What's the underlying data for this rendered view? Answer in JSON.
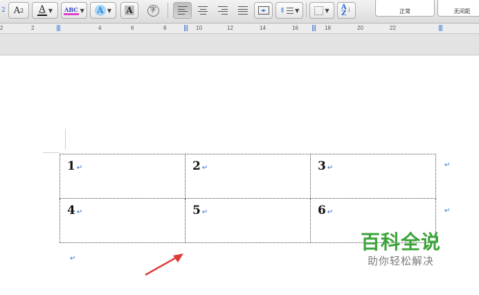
{
  "toolbar": {
    "subscript_glyph": "A",
    "subscript_sub": "2",
    "font_color_glyph": "A",
    "highlight_label": "ABC",
    "text_effects_glyph": "A",
    "char_shading_glyph": "A",
    "enclose_glyph": "字",
    "font_color_bar": "#111111",
    "highlight_color": "#e040c8",
    "text_effects_color": "#2d8bd6"
  },
  "styles": {
    "normal_label": "正常",
    "no_spacing_label": "无间距"
  },
  "ruler": {
    "ticks": [
      "2",
      "2",
      "4",
      "6",
      "8",
      "10",
      "12",
      "14",
      "16",
      "18",
      "20",
      "22"
    ]
  },
  "table": {
    "rows": [
      [
        "1",
        "2",
        "3"
      ],
      [
        "4",
        "5",
        "6"
      ]
    ],
    "mark": "↵"
  },
  "arrow_color": "#e03a3a",
  "watermark": {
    "title": "百科全说",
    "subtitle": "助你轻松解决"
  }
}
